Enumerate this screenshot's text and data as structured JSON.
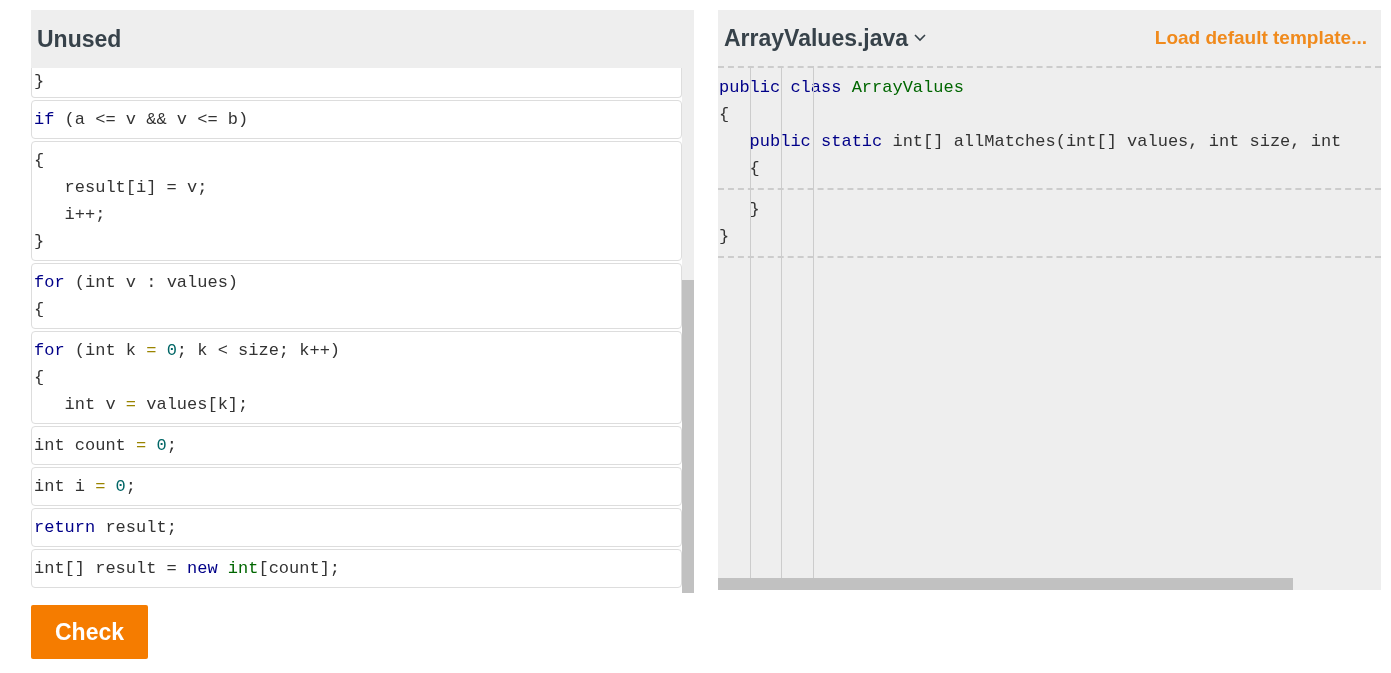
{
  "unused_panel": {
    "title": "Unused",
    "blocks": [
      {
        "lines": [
          [
            {
              "text": "}",
              "color": "#333333"
            }
          ]
        ]
      },
      {
        "lines": [
          [
            {
              "text": "if",
              "color": "#000088"
            },
            {
              "text": " (a <= v && v <= b)",
              "color": "#333333"
            }
          ]
        ]
      },
      {
        "lines": [
          [
            {
              "text": "{",
              "color": "#333333"
            }
          ],
          [
            {
              "text": "   result[i] = v;",
              "color": "#333333"
            }
          ],
          [
            {
              "text": "   i++;",
              "color": "#333333"
            }
          ],
          [
            {
              "text": "}",
              "color": "#333333"
            }
          ]
        ]
      },
      {
        "lines": [
          [
            {
              "text": "for",
              "color": "#000088"
            },
            {
              "text": " (int v : values)",
              "color": "#333333"
            }
          ],
          [
            {
              "text": "{",
              "color": "#333333"
            }
          ]
        ]
      },
      {
        "lines": [
          [
            {
              "text": "for",
              "color": "#000088"
            },
            {
              "text": " (int k ",
              "color": "#333333"
            },
            {
              "text": "=",
              "color": "#9a8400"
            },
            {
              "text": " 0",
              "color": "#006666"
            },
            {
              "text": "; k < size; k++)",
              "color": "#333333"
            }
          ],
          [
            {
              "text": "{",
              "color": "#333333"
            }
          ],
          [
            {
              "text": "   int v ",
              "color": "#333333"
            },
            {
              "text": "=",
              "color": "#9a8400"
            },
            {
              "text": " values[k];",
              "color": "#333333"
            }
          ]
        ]
      },
      {
        "lines": [
          [
            {
              "text": "int count ",
              "color": "#333333"
            },
            {
              "text": "=",
              "color": "#9a8400"
            },
            {
              "text": " 0",
              "color": "#006666"
            },
            {
              "text": ";",
              "color": "#333333"
            }
          ]
        ]
      },
      {
        "lines": [
          [
            {
              "text": "int i ",
              "color": "#333333"
            },
            {
              "text": "=",
              "color": "#9a8400"
            },
            {
              "text": " 0",
              "color": "#006666"
            },
            {
              "text": ";",
              "color": "#333333"
            }
          ]
        ]
      },
      {
        "lines": [
          [
            {
              "text": "return",
              "color": "#000088"
            },
            {
              "text": " result;",
              "color": "#333333"
            }
          ]
        ]
      },
      {
        "lines": [
          [
            {
              "text": "int[] result = ",
              "color": "#333333"
            },
            {
              "text": "new",
              "color": "#000088"
            },
            {
              "text": " int",
              "color": "#006600"
            },
            {
              "text": "[count];",
              "color": "#333333"
            }
          ]
        ]
      }
    ]
  },
  "check_button": "Check",
  "editor": {
    "file": "ArrayValues.java",
    "template_link": "Load default template...",
    "sections": [
      {
        "lines": [
          [
            {
              "text": "public",
              "color": "#000088"
            },
            {
              "text": " class",
              "color": "#000088"
            },
            {
              "text": " ArrayValues",
              "color": "#006600"
            }
          ],
          [
            {
              "text": "{",
              "color": "#333333"
            }
          ],
          [
            {
              "text": "   public",
              "color": "#000088"
            },
            {
              "text": " static",
              "color": "#000088"
            },
            {
              "text": " int[] allMatches(int[] values, int size, int",
              "color": "#333333"
            }
          ],
          [
            {
              "text": "   {",
              "color": "#333333"
            }
          ]
        ]
      },
      {
        "lines": [
          [
            {
              "text": "   }",
              "color": "#333333"
            }
          ],
          [
            {
              "text": "}",
              "color": "#333333"
            }
          ]
        ]
      }
    ]
  }
}
